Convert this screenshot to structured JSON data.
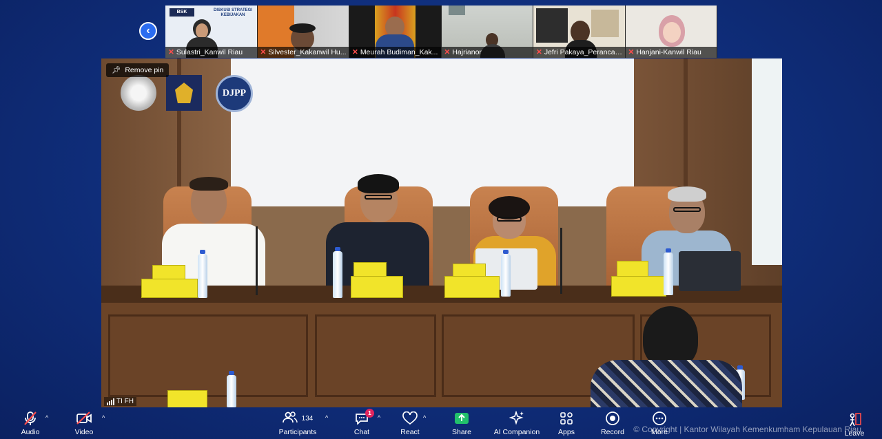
{
  "filmstrip": {
    "participants": [
      {
        "name": "Sulastri_Kanwil Riau",
        "muted": true,
        "banner_title": "DISKUSI STRATEGI KEBIJAKAN",
        "banner_logo": "BSK"
      },
      {
        "name": "Silvester_Kakanwil Hu...",
        "muted": true
      },
      {
        "name": "Meurah Budiman_Kak...",
        "muted": true
      },
      {
        "name": "Hajrianor",
        "muted": true
      },
      {
        "name": "Jefri Pakaya_Perancan...",
        "muted": true
      },
      {
        "name": "Hanjani-Kanwil Riau",
        "muted": true
      }
    ]
  },
  "pinned_video": {
    "remove_pin_label": "Remove pin",
    "speaker_label": "TI FH",
    "logo_text": "DJPP"
  },
  "toolbar": {
    "audio": "Audio",
    "video": "Video",
    "participants": "Participants",
    "participants_count": "134",
    "chat": "Chat",
    "chat_badge": "1",
    "react": "React",
    "share": "Share",
    "ai_companion": "AI Companion",
    "apps": "Apps",
    "record": "Record",
    "more": "More",
    "leave": "Leave"
  },
  "watermark": "© Copyright | Kantor Wilayah Kemenkumham Kepulauan Riau",
  "colors": {
    "share_green": "#22c06b",
    "mute_red": "#ff4d4d",
    "accent_blue": "#2b6cf0",
    "badge_pink": "#e0245e",
    "leave_red": "#e5484d"
  }
}
